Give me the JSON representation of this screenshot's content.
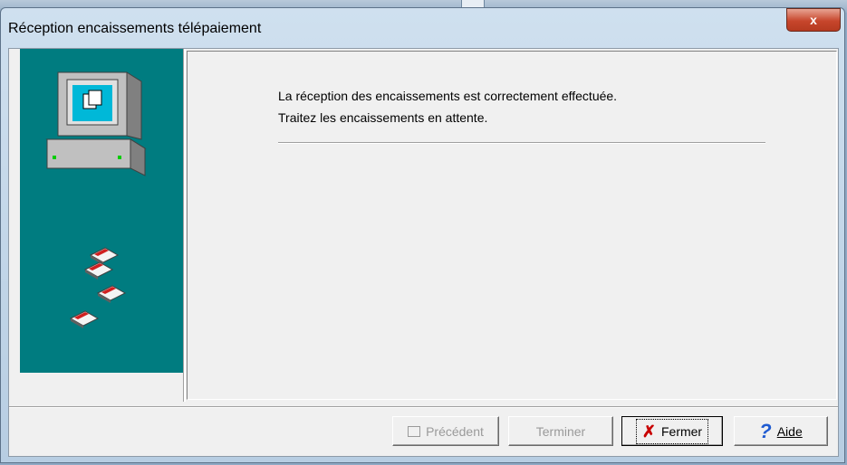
{
  "window": {
    "title": "Réception encaissements télépaiement",
    "close_glyph": "x"
  },
  "message": {
    "line1": "La réception des encaissements est correctement effectuée.",
    "line2": "Traitez les encaissements en attente."
  },
  "buttons": {
    "previous": "Précédent",
    "finish": "Terminer",
    "close": "Fermer",
    "help": "Aide"
  },
  "icons": {
    "computer": "computer-icon",
    "disks": "floppy-disk-icon",
    "close": "x-icon",
    "help": "question-mark-icon"
  },
  "colors": {
    "side_panel": "#007c80",
    "close_x": "#c80000",
    "help_q": "#1f5bd1"
  }
}
